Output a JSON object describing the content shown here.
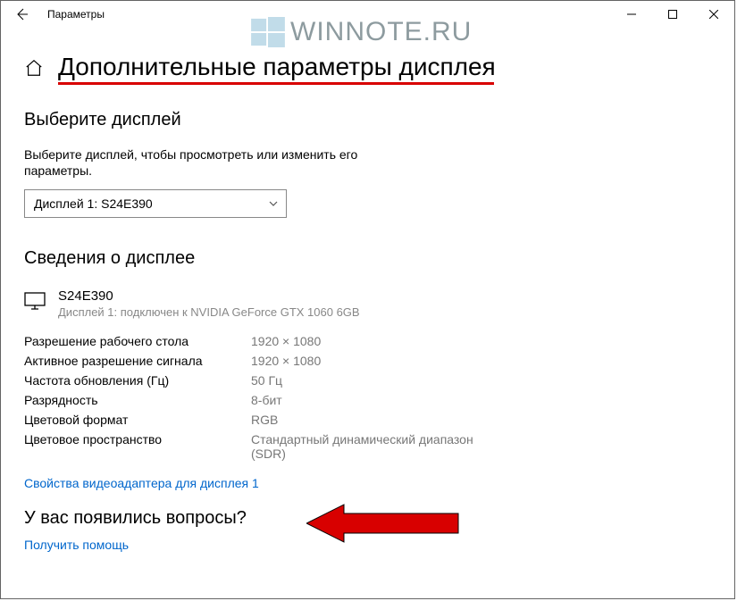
{
  "window": {
    "title": "Параметры"
  },
  "watermark": {
    "text": "WINNOTE.RU"
  },
  "page": {
    "title": "Дополнительные параметры дисплея"
  },
  "select_display": {
    "heading": "Выберите дисплей",
    "prompt": "Выберите дисплей, чтобы просмотреть или изменить его параметры.",
    "selected": "Дисплей 1: S24E390"
  },
  "display_info": {
    "heading": "Сведения о дисплее",
    "device_name": "S24E390",
    "device_sub": "Дисплей 1: подключен к NVIDIA GeForce GTX 1060 6GB",
    "rows": [
      {
        "label": "Разрешение рабочего стола",
        "value": "1920 × 1080"
      },
      {
        "label": "Активное разрешение сигнала",
        "value": "1920 × 1080"
      },
      {
        "label": "Частота обновления (Гц)",
        "value": "50 Гц"
      },
      {
        "label": "Разрядность",
        "value": "8-бит"
      },
      {
        "label": "Цветовой формат",
        "value": "RGB"
      },
      {
        "label": "Цветовое пространство",
        "value": "Стандартный динамический диапазон (SDR)"
      }
    ],
    "adapter_link": "Свойства видеоадаптера для дисплея 1"
  },
  "help": {
    "heading": "У вас появились вопросы?",
    "link": "Получить помощь"
  }
}
